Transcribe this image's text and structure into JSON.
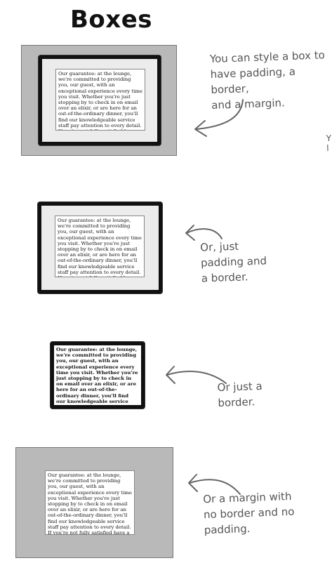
{
  "title": "Boxes",
  "box_text": "Our guarantee: at the lounge, we're committed to providing you, our guest, with an exceptional experience every time you visit. Whether you're just stopping by to check in on email over an elixir, or are here for an out-of-the-ordinary dinner, you'll find our knowledgeable service staff pay attention to every detail. If you're not fully satisfied have a Blueberry Bliss Elixir on us.",
  "annotations": {
    "a1": [
      "You can style a box to",
      "have padding, a border,",
      "and a margin."
    ],
    "a2": [
      "Or, just",
      "padding and",
      "a border."
    ],
    "a3": [
      "Or just a",
      "border."
    ],
    "a4": [
      "Or a margin with",
      "no border and no",
      "padding."
    ],
    "cut": [
      "Y",
      "l"
    ]
  }
}
